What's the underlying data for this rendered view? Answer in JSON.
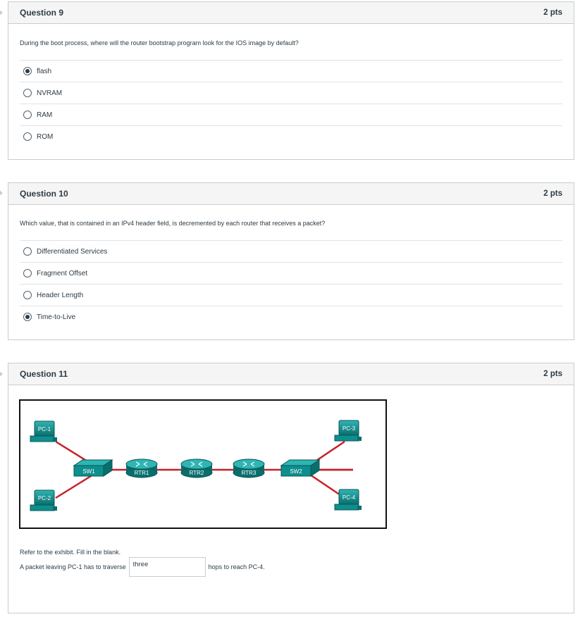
{
  "questions": [
    {
      "title": "Question 9",
      "points": "2 pts",
      "text": "During the boot process, where will the router bootstrap program look for the IOS image by default?",
      "answers": [
        {
          "label": "flash",
          "selected": true
        },
        {
          "label": "NVRAM",
          "selected": false
        },
        {
          "label": "RAM",
          "selected": false
        },
        {
          "label": "ROM",
          "selected": false
        }
      ]
    },
    {
      "title": "Question 10",
      "points": "2 pts",
      "text": "Which value, that is contained in an IPv4 header field, is decremented by each router that receives a packet?",
      "answers": [
        {
          "label": "Differentiated Services",
          "selected": false
        },
        {
          "label": "Fragment Offset",
          "selected": false
        },
        {
          "label": "Header Length",
          "selected": false
        },
        {
          "label": "Time-to-Live",
          "selected": true
        }
      ]
    },
    {
      "title": "Question 11",
      "points": "2 pts",
      "exhibit": {
        "devices": {
          "pc1": "PC-1",
          "pc2": "PC-2",
          "pc3": "PC-3",
          "pc4": "PC-4",
          "sw1": "SW1",
          "sw2": "SW2",
          "rtr1": "RTR1",
          "rtr2": "RTR2",
          "rtr3": "RTR3"
        },
        "colors": {
          "link": "#c8202a",
          "device": "#0d8f8e",
          "device_dark": "#0a6e6d"
        }
      },
      "instruction": "Refer to the exhibit. Fill in the blank.",
      "sentence_before": "A packet leaving PC-1 has to traverse",
      "blank_value": "three",
      "sentence_after": "hops to reach PC-4."
    }
  ]
}
